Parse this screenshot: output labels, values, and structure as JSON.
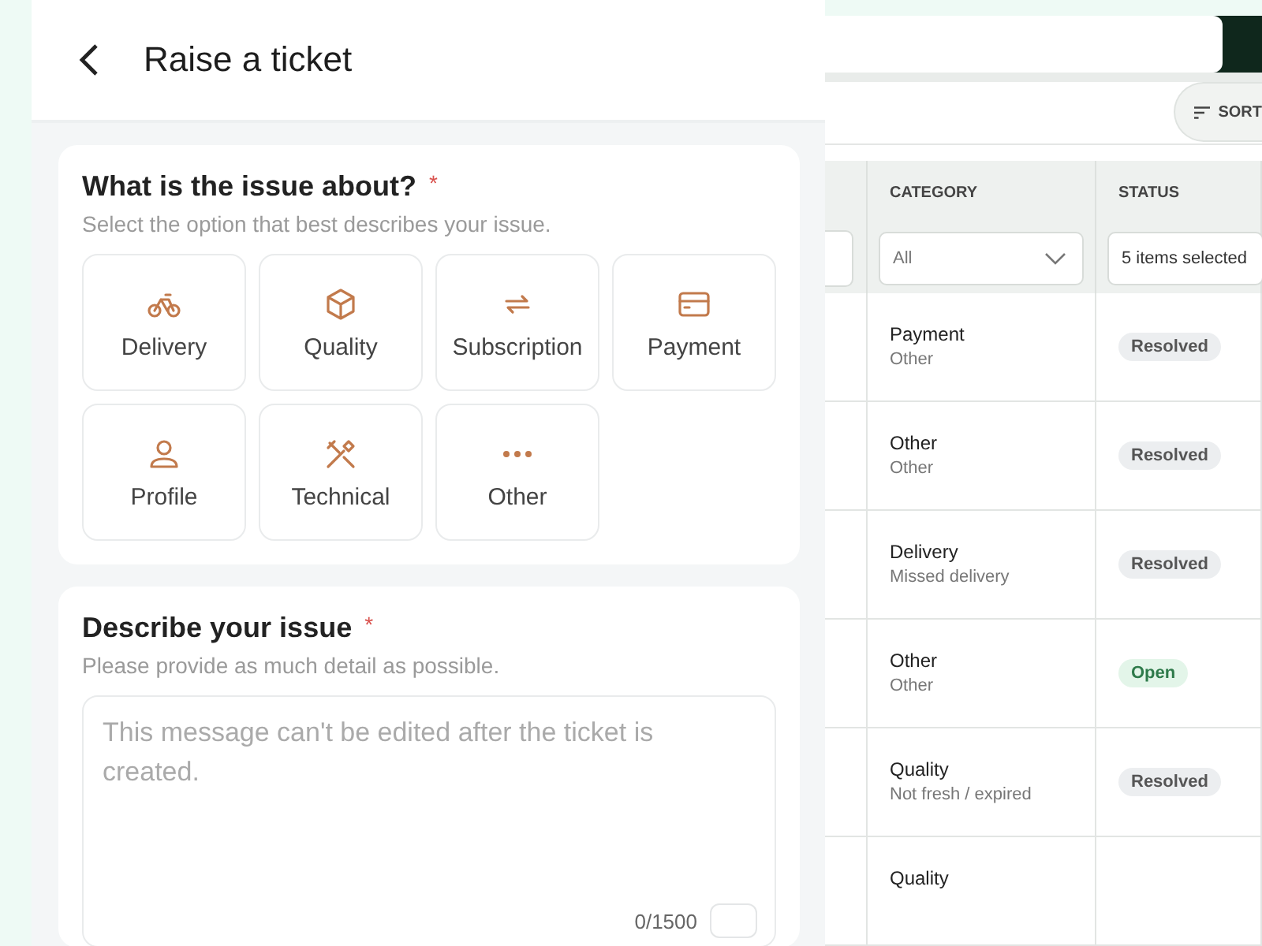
{
  "ticket_panel": {
    "title": "Raise a ticket",
    "issue_section": {
      "heading": "What is the issue about?",
      "required_mark": "*",
      "hint": "Select the option that best describes your issue.",
      "options": [
        {
          "label": "Delivery",
          "selected": false
        },
        {
          "label": "Quality",
          "selected": false
        },
        {
          "label": "Subscription",
          "selected": false
        },
        {
          "label": "Payment",
          "selected": false
        },
        {
          "label": "Profile",
          "selected": false
        },
        {
          "label": "Technical",
          "selected": false
        },
        {
          "label": "Other",
          "selected": false
        }
      ]
    },
    "describe_section": {
      "heading": "Describe your issue",
      "required_mark": "*",
      "hint": "Please provide as much detail as possible.",
      "field": {
        "placeholder": "This message can't be edited after the ticket is created.",
        "counter": "0/1500"
      }
    }
  },
  "background_app": {
    "sort_button": {
      "label": "SORT"
    },
    "table": {
      "columns": [
        "CATEGORY",
        "STATUS"
      ],
      "filters": {
        "category": "All",
        "status": "5 items selected"
      },
      "rows": [
        {
          "category": "Payment",
          "subcategory": "Other",
          "status": {
            "label": "Resolved",
            "kind": "resolved"
          }
        },
        {
          "category": "Other",
          "subcategory": "Other",
          "status": {
            "label": "Resolved",
            "kind": "resolved"
          }
        },
        {
          "category": "Delivery",
          "subcategory": "Missed delivery",
          "status": {
            "label": "Resolved",
            "kind": "resolved"
          }
        },
        {
          "category": "Other",
          "subcategory": "Other",
          "status": {
            "label": "Open",
            "kind": "open"
          }
        },
        {
          "category": "Quality",
          "subcategory": "Not fresh / expired",
          "status": {
            "label": "Resolved",
            "kind": "resolved"
          }
        },
        {
          "category": "Quality"
        }
      ]
    }
  }
}
